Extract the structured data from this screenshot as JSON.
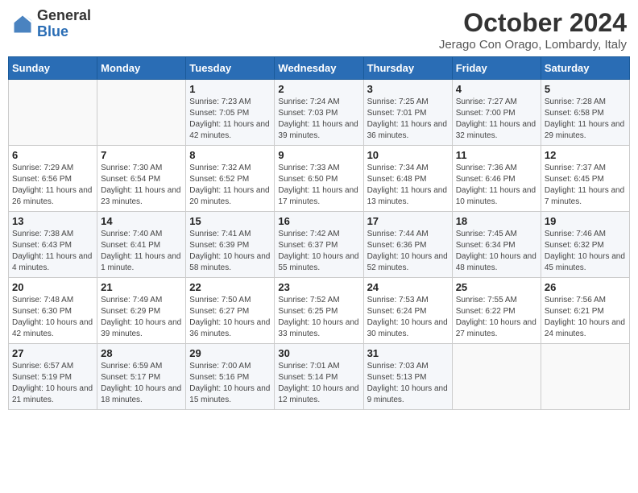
{
  "header": {
    "logo_line1": "General",
    "logo_line2": "Blue",
    "month": "October 2024",
    "location": "Jerago Con Orago, Lombardy, Italy"
  },
  "days_of_week": [
    "Sunday",
    "Monday",
    "Tuesday",
    "Wednesday",
    "Thursday",
    "Friday",
    "Saturday"
  ],
  "weeks": [
    [
      {
        "day": "",
        "info": ""
      },
      {
        "day": "",
        "info": ""
      },
      {
        "day": "1",
        "info": "Sunrise: 7:23 AM\nSunset: 7:05 PM\nDaylight: 11 hours and 42 minutes."
      },
      {
        "day": "2",
        "info": "Sunrise: 7:24 AM\nSunset: 7:03 PM\nDaylight: 11 hours and 39 minutes."
      },
      {
        "day": "3",
        "info": "Sunrise: 7:25 AM\nSunset: 7:01 PM\nDaylight: 11 hours and 36 minutes."
      },
      {
        "day": "4",
        "info": "Sunrise: 7:27 AM\nSunset: 7:00 PM\nDaylight: 11 hours and 32 minutes."
      },
      {
        "day": "5",
        "info": "Sunrise: 7:28 AM\nSunset: 6:58 PM\nDaylight: 11 hours and 29 minutes."
      }
    ],
    [
      {
        "day": "6",
        "info": "Sunrise: 7:29 AM\nSunset: 6:56 PM\nDaylight: 11 hours and 26 minutes."
      },
      {
        "day": "7",
        "info": "Sunrise: 7:30 AM\nSunset: 6:54 PM\nDaylight: 11 hours and 23 minutes."
      },
      {
        "day": "8",
        "info": "Sunrise: 7:32 AM\nSunset: 6:52 PM\nDaylight: 11 hours and 20 minutes."
      },
      {
        "day": "9",
        "info": "Sunrise: 7:33 AM\nSunset: 6:50 PM\nDaylight: 11 hours and 17 minutes."
      },
      {
        "day": "10",
        "info": "Sunrise: 7:34 AM\nSunset: 6:48 PM\nDaylight: 11 hours and 13 minutes."
      },
      {
        "day": "11",
        "info": "Sunrise: 7:36 AM\nSunset: 6:46 PM\nDaylight: 11 hours and 10 minutes."
      },
      {
        "day": "12",
        "info": "Sunrise: 7:37 AM\nSunset: 6:45 PM\nDaylight: 11 hours and 7 minutes."
      }
    ],
    [
      {
        "day": "13",
        "info": "Sunrise: 7:38 AM\nSunset: 6:43 PM\nDaylight: 11 hours and 4 minutes."
      },
      {
        "day": "14",
        "info": "Sunrise: 7:40 AM\nSunset: 6:41 PM\nDaylight: 11 hours and 1 minute."
      },
      {
        "day": "15",
        "info": "Sunrise: 7:41 AM\nSunset: 6:39 PM\nDaylight: 10 hours and 58 minutes."
      },
      {
        "day": "16",
        "info": "Sunrise: 7:42 AM\nSunset: 6:37 PM\nDaylight: 10 hours and 55 minutes."
      },
      {
        "day": "17",
        "info": "Sunrise: 7:44 AM\nSunset: 6:36 PM\nDaylight: 10 hours and 52 minutes."
      },
      {
        "day": "18",
        "info": "Sunrise: 7:45 AM\nSunset: 6:34 PM\nDaylight: 10 hours and 48 minutes."
      },
      {
        "day": "19",
        "info": "Sunrise: 7:46 AM\nSunset: 6:32 PM\nDaylight: 10 hours and 45 minutes."
      }
    ],
    [
      {
        "day": "20",
        "info": "Sunrise: 7:48 AM\nSunset: 6:30 PM\nDaylight: 10 hours and 42 minutes."
      },
      {
        "day": "21",
        "info": "Sunrise: 7:49 AM\nSunset: 6:29 PM\nDaylight: 10 hours and 39 minutes."
      },
      {
        "day": "22",
        "info": "Sunrise: 7:50 AM\nSunset: 6:27 PM\nDaylight: 10 hours and 36 minutes."
      },
      {
        "day": "23",
        "info": "Sunrise: 7:52 AM\nSunset: 6:25 PM\nDaylight: 10 hours and 33 minutes."
      },
      {
        "day": "24",
        "info": "Sunrise: 7:53 AM\nSunset: 6:24 PM\nDaylight: 10 hours and 30 minutes."
      },
      {
        "day": "25",
        "info": "Sunrise: 7:55 AM\nSunset: 6:22 PM\nDaylight: 10 hours and 27 minutes."
      },
      {
        "day": "26",
        "info": "Sunrise: 7:56 AM\nSunset: 6:21 PM\nDaylight: 10 hours and 24 minutes."
      }
    ],
    [
      {
        "day": "27",
        "info": "Sunrise: 6:57 AM\nSunset: 5:19 PM\nDaylight: 10 hours and 21 minutes."
      },
      {
        "day": "28",
        "info": "Sunrise: 6:59 AM\nSunset: 5:17 PM\nDaylight: 10 hours and 18 minutes."
      },
      {
        "day": "29",
        "info": "Sunrise: 7:00 AM\nSunset: 5:16 PM\nDaylight: 10 hours and 15 minutes."
      },
      {
        "day": "30",
        "info": "Sunrise: 7:01 AM\nSunset: 5:14 PM\nDaylight: 10 hours and 12 minutes."
      },
      {
        "day": "31",
        "info": "Sunrise: 7:03 AM\nSunset: 5:13 PM\nDaylight: 10 hours and 9 minutes."
      },
      {
        "day": "",
        "info": ""
      },
      {
        "day": "",
        "info": ""
      }
    ]
  ]
}
